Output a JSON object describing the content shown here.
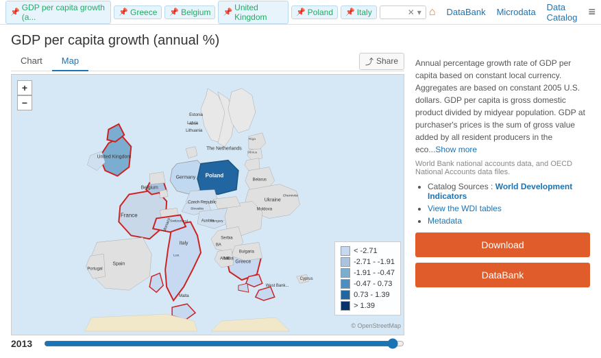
{
  "topnav": {
    "tags": [
      {
        "id": "gdp",
        "label": "GDP per capita growth (a...",
        "pinned": true
      },
      {
        "id": "greece",
        "label": "Greece",
        "pinned": true
      },
      {
        "id": "belgium",
        "label": "Belgium",
        "pinned": true
      },
      {
        "id": "uk",
        "label": "United Kingdom",
        "pinned": true
      },
      {
        "id": "poland",
        "label": "Poland",
        "pinned": true
      },
      {
        "id": "italy",
        "label": "Italy",
        "pinned": true
      }
    ],
    "nav_links": [
      {
        "id": "databank",
        "label": "DataBank"
      },
      {
        "id": "microdata",
        "label": "Microdata"
      },
      {
        "id": "data-catalog",
        "label": "Data Catalog"
      }
    ]
  },
  "page": {
    "title": "GDP per capita growth (annual %)"
  },
  "tabs": [
    {
      "id": "chart",
      "label": "Chart",
      "active": false
    },
    {
      "id": "map",
      "label": "Map",
      "active": true
    }
  ],
  "share_button": "Share",
  "map": {
    "zoom_in": "+",
    "zoom_out": "−"
  },
  "legend": {
    "title": "",
    "items": [
      {
        "label": "< -2.71",
        "color": "#c6d9f0"
      },
      {
        "label": "-2.71 - -1.91",
        "color": "#aac4e0"
      },
      {
        "label": "-1.91 - -0.47",
        "color": "#7aadd0"
      },
      {
        "label": "-0.47 - 0.73",
        "color": "#4d8dbf"
      },
      {
        "label": "0.73 - 1.39",
        "color": "#2166a0"
      },
      {
        "label": "> 1.39",
        "color": "#08306b"
      }
    ]
  },
  "year": {
    "value": "2013",
    "slider_min": 1960,
    "slider_max": 2014,
    "slider_value": 2013
  },
  "sidebar": {
    "description": "Annual percentage growth rate of GDP per capita based on constant local currency. Aggregates are based on constant 2005 U.S. dollars. GDP per capita is gross domestic product divided by midyear population. GDP at purchaser's prices is the sum of gross value added by all resident producers in the eco",
    "show_more": "...Show more",
    "source": "World Bank national accounts data, and OECD National Accounts data files.",
    "catalog_label": "Catalog Sources :",
    "catalog_source": "World Development Indicators",
    "view_wdi_label": "View the WDI tables",
    "metadata_label": "Metadata",
    "download_btn": "Download",
    "databank_btn": "DataBank"
  },
  "attribution": "© OpenStreetMap"
}
